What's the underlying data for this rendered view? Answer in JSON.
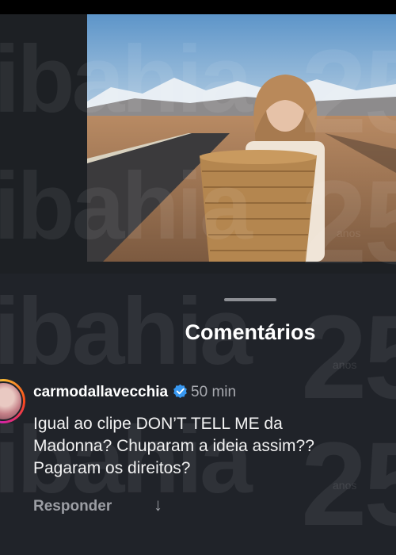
{
  "watermark": {
    "brand": "ibahia",
    "badge_number": "25",
    "badge_caption": "anos"
  },
  "comments_sheet": {
    "title": "Comentários"
  },
  "comment": {
    "username": "carmodallavecchia",
    "verified": true,
    "time": "50 min",
    "text": "Igual ao clipe DON’T TELL ME da\nMadonna? Chuparam a ideia assim??\nPagaram os direitos?",
    "reply_label": "Responder",
    "more_icon": "arrow-down-icon"
  },
  "colors": {
    "sheet_background": "#202329",
    "verified_badge": "#3797f0",
    "secondary_text": "#a8aab0"
  }
}
